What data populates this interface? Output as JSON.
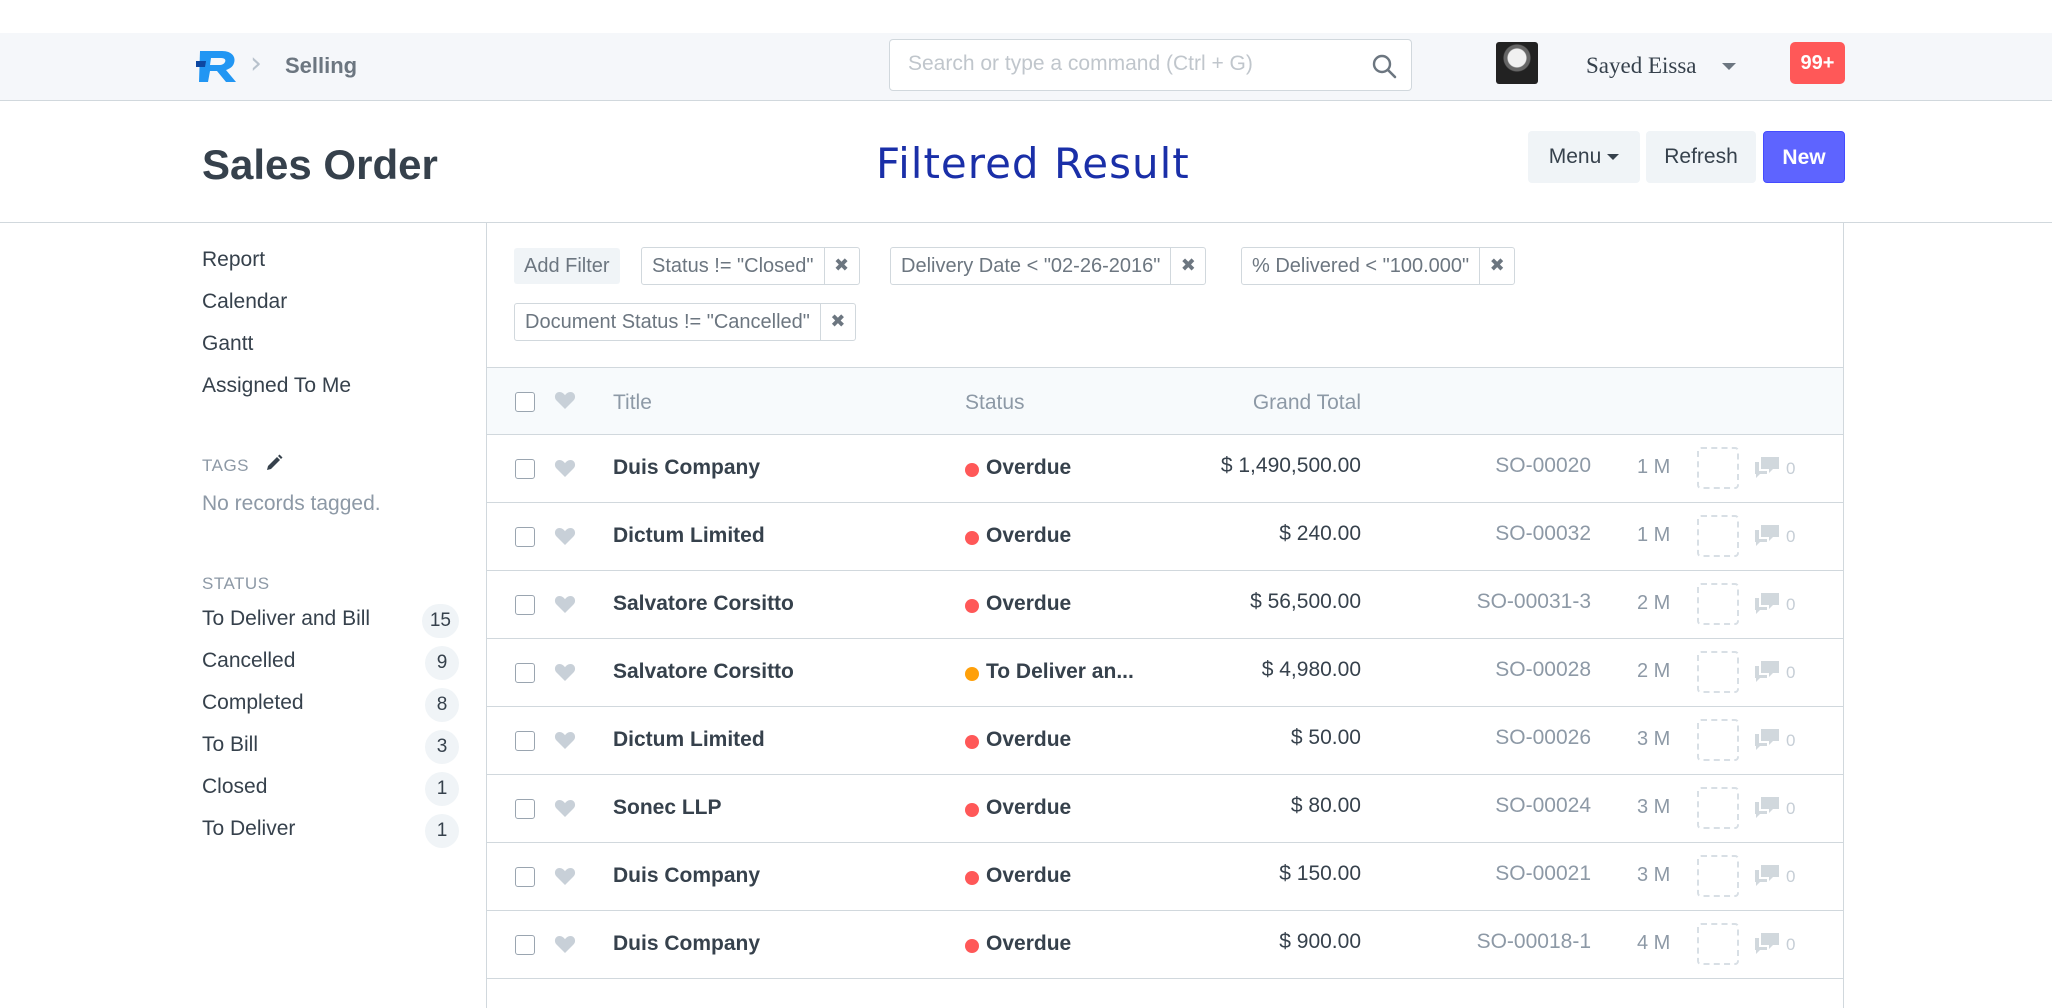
{
  "navbar": {
    "breadcrumb": "Selling",
    "search_placeholder": "Search or type a command (Ctrl + G)",
    "user_name": "Sayed Eissa",
    "notification_badge": "99+"
  },
  "page": {
    "title": "Sales Order",
    "overlay_caption": "Filtered Result",
    "menu_label": "Menu",
    "refresh_label": "Refresh",
    "new_label": "New"
  },
  "sidebar": {
    "links": [
      "Report",
      "Calendar",
      "Gantt",
      "Assigned To Me"
    ],
    "tags_heading": "TAGS",
    "no_tags": "No records tagged.",
    "status_heading": "STATUS",
    "statuses": [
      {
        "label": "To Deliver and Bill",
        "count": "15"
      },
      {
        "label": "Cancelled",
        "count": "9"
      },
      {
        "label": "Completed",
        "count": "8"
      },
      {
        "label": "To Bill",
        "count": "3"
      },
      {
        "label": "Closed",
        "count": "1"
      },
      {
        "label": "To Deliver",
        "count": "1"
      }
    ]
  },
  "filters": {
    "add_filter_label": "Add Filter",
    "chips": [
      "Status != \"Closed\"",
      "Delivery Date < \"02-26-2016\"",
      "% Delivered < \"100.000\"",
      "Document Status != \"Cancelled\""
    ]
  },
  "list": {
    "headers": {
      "title": "Title",
      "status": "Status",
      "grand_total": "Grand Total"
    },
    "rows": [
      {
        "title": "Duis Company",
        "status": "Overdue",
        "status_color": "#ff5858",
        "total": "$ 1,490,500.00",
        "name": "SO-00020",
        "age": "1 M",
        "comments": "0"
      },
      {
        "title": "Dictum Limited",
        "status": "Overdue",
        "status_color": "#ff5858",
        "total": "$ 240.00",
        "name": "SO-00032",
        "age": "1 M",
        "comments": "0"
      },
      {
        "title": "Salvatore Corsitto",
        "status": "Overdue",
        "status_color": "#ff5858",
        "total": "$ 56,500.00",
        "name": "SO-00031-3",
        "age": "2 M",
        "comments": "0"
      },
      {
        "title": "Salvatore Corsitto",
        "status": "To Deliver an...",
        "status_color": "#ffa00a",
        "total": "$ 4,980.00",
        "name": "SO-00028",
        "age": "2 M",
        "comments": "0"
      },
      {
        "title": "Dictum Limited",
        "status": "Overdue",
        "status_color": "#ff5858",
        "total": "$ 50.00",
        "name": "SO-00026",
        "age": "3 M",
        "comments": "0"
      },
      {
        "title": "Sonec LLP",
        "status": "Overdue",
        "status_color": "#ff5858",
        "total": "$ 80.00",
        "name": "SO-00024",
        "age": "3 M",
        "comments": "0"
      },
      {
        "title": "Duis Company",
        "status": "Overdue",
        "status_color": "#ff5858",
        "total": "$ 150.00",
        "name": "SO-00021",
        "age": "3 M",
        "comments": "0"
      },
      {
        "title": "Duis Company",
        "status": "Overdue",
        "status_color": "#ff5858",
        "total": "$ 900.00",
        "name": "SO-00018-1",
        "age": "4 M",
        "comments": "0"
      }
    ]
  },
  "colors": {
    "primary": "#5e64ff",
    "overdue": "#ff5858",
    "to_deliver": "#ffa00a",
    "caption": "#1a2fa8"
  },
  "icons": [
    "app-logo-icon",
    "chevron-right-icon",
    "search-icon",
    "caret-down-icon",
    "edit-icon",
    "heart-icon",
    "comment-icon",
    "remove-icon"
  ]
}
